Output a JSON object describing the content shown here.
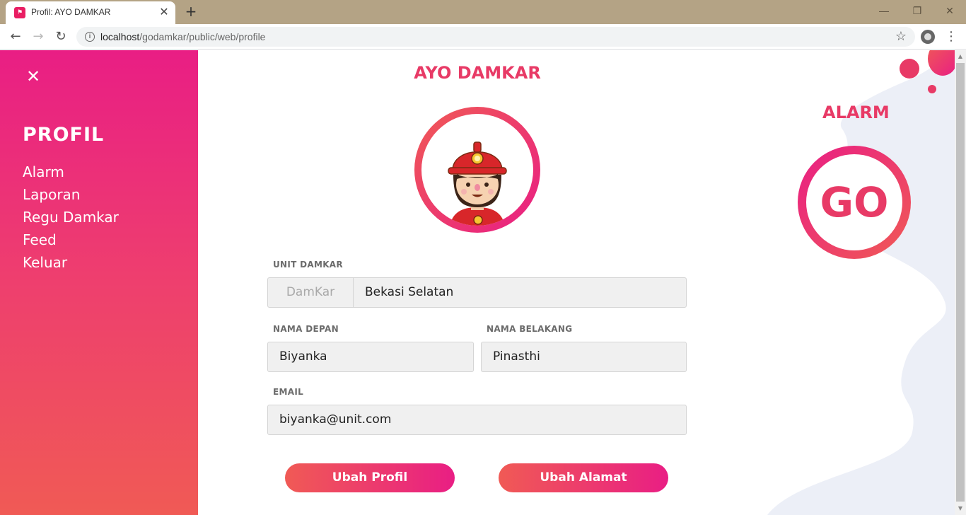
{
  "browser": {
    "tab_title": "Profil: AYO DAMKAR",
    "url_host": "localhost",
    "url_path": "/godamkar/public/web/profile"
  },
  "sidebar": {
    "title": "PROFIL",
    "items": [
      {
        "label": "Alarm"
      },
      {
        "label": "Laporan"
      },
      {
        "label": "Regu Damkar"
      },
      {
        "label": "Feed"
      },
      {
        "label": "Keluar"
      }
    ]
  },
  "main": {
    "app_title": "AYO DAMKAR",
    "unit_label": "UNIT DAMKAR",
    "unit_prefix": "DamKar",
    "unit_value": "Bekasi Selatan",
    "first_name_label": "NAMA DEPAN",
    "first_name_value": "Biyanka",
    "last_name_label": "NAMA BELAKANG",
    "last_name_value": "Pinasthi",
    "email_label": "EMAIL",
    "email_value": "biyanka@unit.com",
    "edit_profile_button": "Ubah Profil",
    "edit_address_button": "Ubah Alamat"
  },
  "alarm": {
    "title": "ALARM",
    "go_label": "GO"
  },
  "colors": {
    "accent_pink": "#e91e84",
    "accent_coral": "#f05a55",
    "title_pink": "#e83a66",
    "field_bg": "#f0f0f0"
  }
}
